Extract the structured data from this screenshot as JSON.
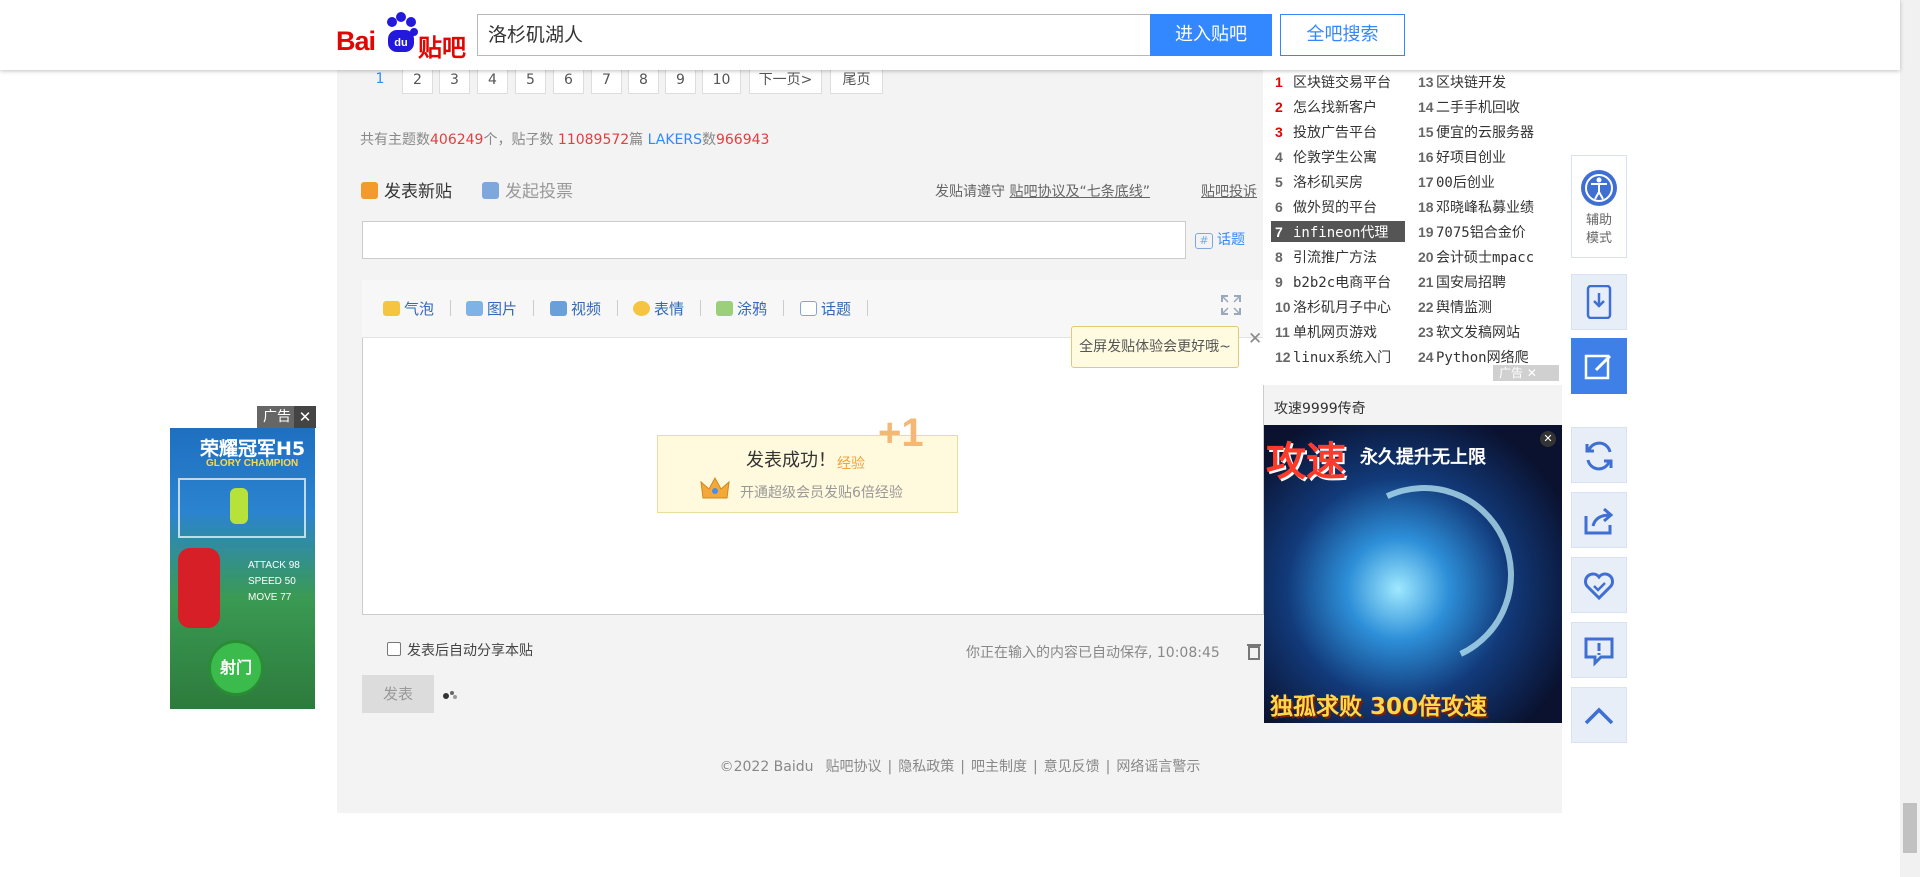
{
  "header": {
    "logo_text_1": "Bai",
    "logo_text_2": "贴吧",
    "search_value": "洛杉矶湖人",
    "enter_label": "进入贴吧",
    "search_all_label": "全吧搜索"
  },
  "pagination": {
    "pages": [
      "1",
      "2",
      "3",
      "4",
      "5",
      "6",
      "7",
      "8",
      "9",
      "10"
    ],
    "current": "1",
    "next_label": "下一页>",
    "last_label": "尾页"
  },
  "stats": {
    "prefix": "共有主题数",
    "topics": "406249",
    "mid1": "个，贴子数 ",
    "posts": "11089572",
    "mid2": "篇 ",
    "lakers_label": "LAKERS",
    "mid3": "数",
    "lakers_count": "966943"
  },
  "composer": {
    "post_tab": "发表新贴",
    "vote_tab": "发起投票",
    "rules_prefix": "发贴请遵守 ",
    "rules_link": "贴吧协议及“七条底线”",
    "report_link": "贴吧投诉",
    "topic_btn": "话题",
    "tools": [
      "气泡",
      "图片",
      "视频",
      "表情",
      "涂鸦",
      "话题"
    ],
    "tooltip": "全屏发贴体验会更好哦~",
    "success_title": "发表成功！",
    "exp_label": "经验",
    "plus_one": "+1",
    "vip_text": "开通超级会员发贴6倍经验",
    "share_label": "发表后自动分享本贴",
    "autosave": "你正在输入的内容已自动保存, 10:08:45",
    "submit_label": "发表"
  },
  "footer": {
    "copyright": "©2022 Baidu",
    "links": [
      "贴吧协议",
      "隐私政策",
      "吧主制度",
      "意见反馈",
      "网络谣言警示"
    ]
  },
  "rank_left": [
    {
      "n": "1",
      "t": "区块链交易平台"
    },
    {
      "n": "2",
      "t": "怎么找新客户"
    },
    {
      "n": "3",
      "t": "投放广告平台"
    },
    {
      "n": "4",
      "t": "伦敦学生公寓"
    },
    {
      "n": "5",
      "t": "洛杉矶买房"
    },
    {
      "n": "6",
      "t": "做外贸的平台"
    },
    {
      "n": "7",
      "t": "infineon代理"
    },
    {
      "n": "8",
      "t": "引流推广方法"
    },
    {
      "n": "9",
      "t": "b2b2c电商平台"
    },
    {
      "n": "10",
      "t": "洛杉矶月子中心"
    },
    {
      "n": "11",
      "t": "单机网页游戏"
    },
    {
      "n": "12",
      "t": "linux系统入门"
    }
  ],
  "rank_right": [
    {
      "n": "13",
      "t": "区块链开发"
    },
    {
      "n": "14",
      "t": "二手手机回收"
    },
    {
      "n": "15",
      "t": "便宜的云服务器"
    },
    {
      "n": "16",
      "t": "好项目创业"
    },
    {
      "n": "17",
      "t": "00后创业"
    },
    {
      "n": "18",
      "t": "邓晓峰私募业绩"
    },
    {
      "n": "19",
      "t": "7075铝合金价"
    },
    {
      "n": "20",
      "t": "会计硕士mpacc"
    },
    {
      "n": "21",
      "t": "国安局招聘"
    },
    {
      "n": "22",
      "t": "舆情监测"
    },
    {
      "n": "23",
      "t": "软文发稿网站"
    },
    {
      "n": "24",
      "t": "Python网络爬"
    }
  ],
  "ads": {
    "rank_ad_label": "广告",
    "game_title": "攻速9999传奇",
    "game_big": "攻速",
    "game_tag": "永久提升无上限",
    "game_bottom": "独孤求败 300倍攻速",
    "left_tag": "广告",
    "left_title": "荣耀冠军H5",
    "left_sub": "GLORY CHAMPION",
    "left_stats": [
      "ATTACK 98",
      "SPEED 50",
      "MOVE 77"
    ],
    "left_btn": "射门"
  },
  "side": {
    "assist_label": "辅助模式"
  }
}
